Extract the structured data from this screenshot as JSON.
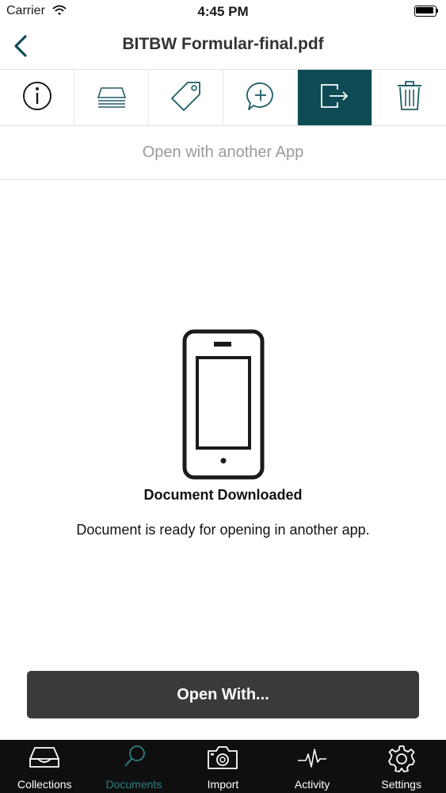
{
  "status_bar": {
    "carrier": "Carrier",
    "time": "4:45 PM"
  },
  "nav": {
    "title": "BITBW Formular-final.pdf"
  },
  "toolbar": {
    "items": [
      {
        "icon": "info-icon"
      },
      {
        "icon": "stack-icon"
      },
      {
        "icon": "tag-icon"
      },
      {
        "icon": "add-comment-icon"
      },
      {
        "icon": "export-icon",
        "active": true
      },
      {
        "icon": "trash-icon"
      }
    ]
  },
  "subheader": {
    "text": "Open with another App"
  },
  "message": {
    "title": "Document Downloaded",
    "body": "Document is ready for opening in another app."
  },
  "open_button": {
    "label": "Open With..."
  },
  "tabs": [
    {
      "label": "Collections",
      "icon": "inbox-tray-icon"
    },
    {
      "label": "Documents",
      "icon": "search-icon",
      "active": true
    },
    {
      "label": "Import",
      "icon": "camera-icon"
    },
    {
      "label": "Activity",
      "icon": "pulse-icon"
    },
    {
      "label": "Settings",
      "icon": "gear-icon"
    }
  ],
  "colors": {
    "accent": "#0e4c55",
    "active_tab": "#2f7d86",
    "tab_bar_bg": "#0f0f0f",
    "button_bg": "#3a3a3a"
  }
}
